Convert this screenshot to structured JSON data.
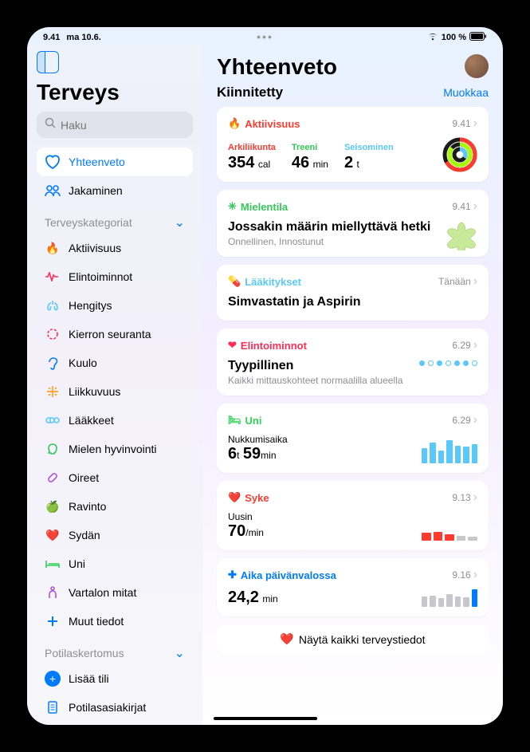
{
  "status": {
    "time": "9.41",
    "date": "ma 10.6.",
    "battery": "100 %"
  },
  "sidebar": {
    "title": "Terveys",
    "search_placeholder": "Haku",
    "items_top": [
      {
        "label": "Yhteenveto",
        "color": "#007aff"
      },
      {
        "label": "Jakaminen",
        "color": "#007aff"
      }
    ],
    "section_categories": "Terveyskategoriat",
    "categories": [
      {
        "label": "Aktiivisuus",
        "color": "#ff3b30"
      },
      {
        "label": "Elintoiminnot",
        "color": "#ff2d55"
      },
      {
        "label": "Hengitys",
        "color": "#5ac8fa"
      },
      {
        "label": "Kierron seuranta",
        "color": "#ff2d55"
      },
      {
        "label": "Kuulo",
        "color": "#007aff"
      },
      {
        "label": "Liikkuvuus",
        "color": "#ff9500"
      },
      {
        "label": "Lääkkeet",
        "color": "#5ac8fa"
      },
      {
        "label": "Mielen hyvinvointi",
        "color": "#34c759"
      },
      {
        "label": "Oireet",
        "color": "#af52de"
      },
      {
        "label": "Ravinto",
        "color": "#34c759"
      },
      {
        "label": "Sydän",
        "color": "#ff3b30"
      },
      {
        "label": "Uni",
        "color": "#30d158"
      },
      {
        "label": "Vartalon mitat",
        "color": "#af52de"
      },
      {
        "label": "Muut tiedot",
        "color": "#007aff"
      }
    ],
    "section_records": "Potilaskertomus",
    "records": [
      {
        "label": "Lisää tili",
        "color": "#007aff"
      },
      {
        "label": "Potilasasiakirjat",
        "color": "#007aff"
      }
    ]
  },
  "main": {
    "title": "Yhteenveto",
    "pinned_title": "Kiinnitetty",
    "edit_label": "Muokkaa",
    "activity": {
      "label": "Aktiivisuus",
      "time": "9.41",
      "move_label": "Arkiliikunta",
      "move_value": "354",
      "move_unit": "cal",
      "exercise_label": "Treeni",
      "exercise_value": "46",
      "exercise_unit": "min",
      "stand_label": "Seisominen",
      "stand_value": "2",
      "stand_unit": "t"
    },
    "mindfulness": {
      "label": "Mielentila",
      "time": "9.41",
      "title": "Jossakin määrin miellyttävä hetki",
      "subtitle": "Onnellinen, Innostunut"
    },
    "medications": {
      "label": "Lääkitykset",
      "time": "Tänään",
      "title": "Simvastatin ja Aspirin"
    },
    "vitals": {
      "label": "Elintoiminnot",
      "time": "6.29",
      "title": "Tyypillinen",
      "subtitle": "Kaikki mittauskohteet normaalilla alueella"
    },
    "sleep": {
      "label": "Uni",
      "time": "6.29",
      "title": "Nukkumisaika",
      "hours": "6",
      "hours_unit": "t",
      "minutes": "59",
      "minutes_unit": "min"
    },
    "heart": {
      "label": "Syke",
      "time": "9.13",
      "title": "Uusin",
      "value": "70",
      "unit": "/min"
    },
    "daylight": {
      "label": "Aika päivänvalossa",
      "time": "9.16",
      "value": "24,2",
      "unit": "min"
    },
    "show_all": "Näytä kaikki terveystiedot"
  }
}
